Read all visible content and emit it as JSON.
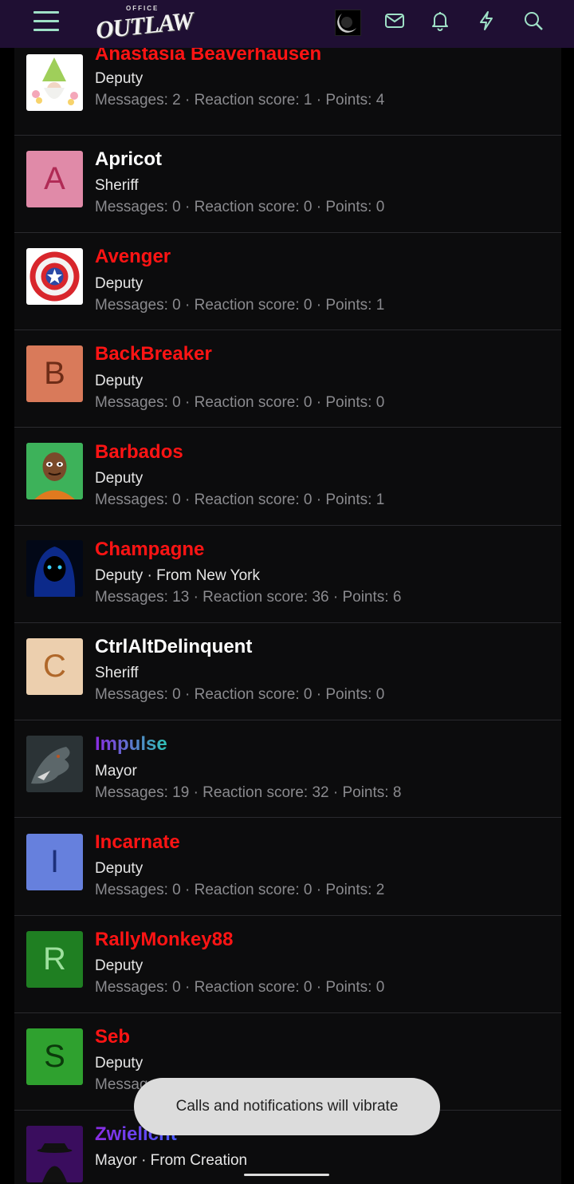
{
  "header": {
    "logo_small": "OFFICE",
    "logo_big": "OUTLAW",
    "icons": [
      "menu-icon",
      "envelope-icon",
      "bell-icon",
      "lightning-icon",
      "search-icon"
    ]
  },
  "members": [
    {
      "name": "Anastasia Beaverhausen",
      "name_color": "#ff1414",
      "title": "Deputy",
      "stats": "Messages: 2 · Reaction score: 1 · Points: 4",
      "avatar": "gnome-image"
    },
    {
      "name": "Apricot",
      "name_color": "#ffffff",
      "title": "Sheriff",
      "stats": "Messages: 0 · Reaction score: 0 · Points: 0",
      "avatar_letter": "A",
      "avatar_bg": "#e08aa8",
      "avatar_fg": "#b02a55"
    },
    {
      "name": "Avenger",
      "name_color": "#ff1414",
      "title": "Deputy",
      "stats": "Messages: 0 · Reaction score: 0 · Points: 1",
      "avatar": "shield-image"
    },
    {
      "name": "BackBreaker",
      "name_color": "#ff1414",
      "title": "Deputy",
      "stats": "Messages: 0 · Reaction score: 0 · Points: 0",
      "avatar_letter": "B",
      "avatar_bg": "#d97a5a",
      "avatar_fg": "#6e2c17"
    },
    {
      "name": "Barbados",
      "name_color": "#ff1414",
      "title": "Deputy",
      "stats": "Messages: 0 · Reaction score: 0 · Points: 1",
      "avatar": "cartoon-man-image"
    },
    {
      "name": "Champagne",
      "name_color": "#ff1414",
      "title": "Deputy · From New York",
      "stats": "Messages: 13 · Reaction score: 36 · Points: 6",
      "avatar": "hooded-figure-image"
    },
    {
      "name": "CtrlAltDelinquent",
      "name_color": "#ffffff",
      "title": "Sheriff",
      "stats": "Messages: 0 · Reaction score: 0 · Points: 0",
      "avatar_letter": "C",
      "avatar_bg": "#eccfae",
      "avatar_fg": "#b0682a"
    },
    {
      "name": "Impulse",
      "name_color": "gradient",
      "title": "Mayor",
      "stats": "Messages: 19 · Reaction score: 32 · Points: 8",
      "avatar": "dragon-image"
    },
    {
      "name": "Incarnate",
      "name_color": "#ff1414",
      "title": "Deputy",
      "stats": "Messages: 0 · Reaction score: 0 · Points: 2",
      "avatar_letter": "I",
      "avatar_bg": "#6680dd",
      "avatar_fg": "#1c2f7a"
    },
    {
      "name": "RallyMonkey88",
      "name_color": "#ff1414",
      "title": "Deputy",
      "stats": "Messages: 0 · Reaction score: 0 · Points: 0",
      "avatar_letter": "R",
      "avatar_bg": "#1f7f22",
      "avatar_fg": "#9ee09e"
    },
    {
      "name": "Seb",
      "name_color": "#ff1414",
      "title": "Deputy",
      "stats": "Messages: 0 · Reaction score: 0 · Points: 0",
      "avatar_letter": "S",
      "avatar_bg": "#2fa12f",
      "avatar_fg": "#0b3a0b"
    },
    {
      "name": "Zwielicht",
      "name_color": "gradient",
      "title": "Mayor · From Creation",
      "stats": "",
      "avatar": "detective-image"
    }
  ],
  "toast": {
    "text": "Calls and notifications will vibrate"
  }
}
